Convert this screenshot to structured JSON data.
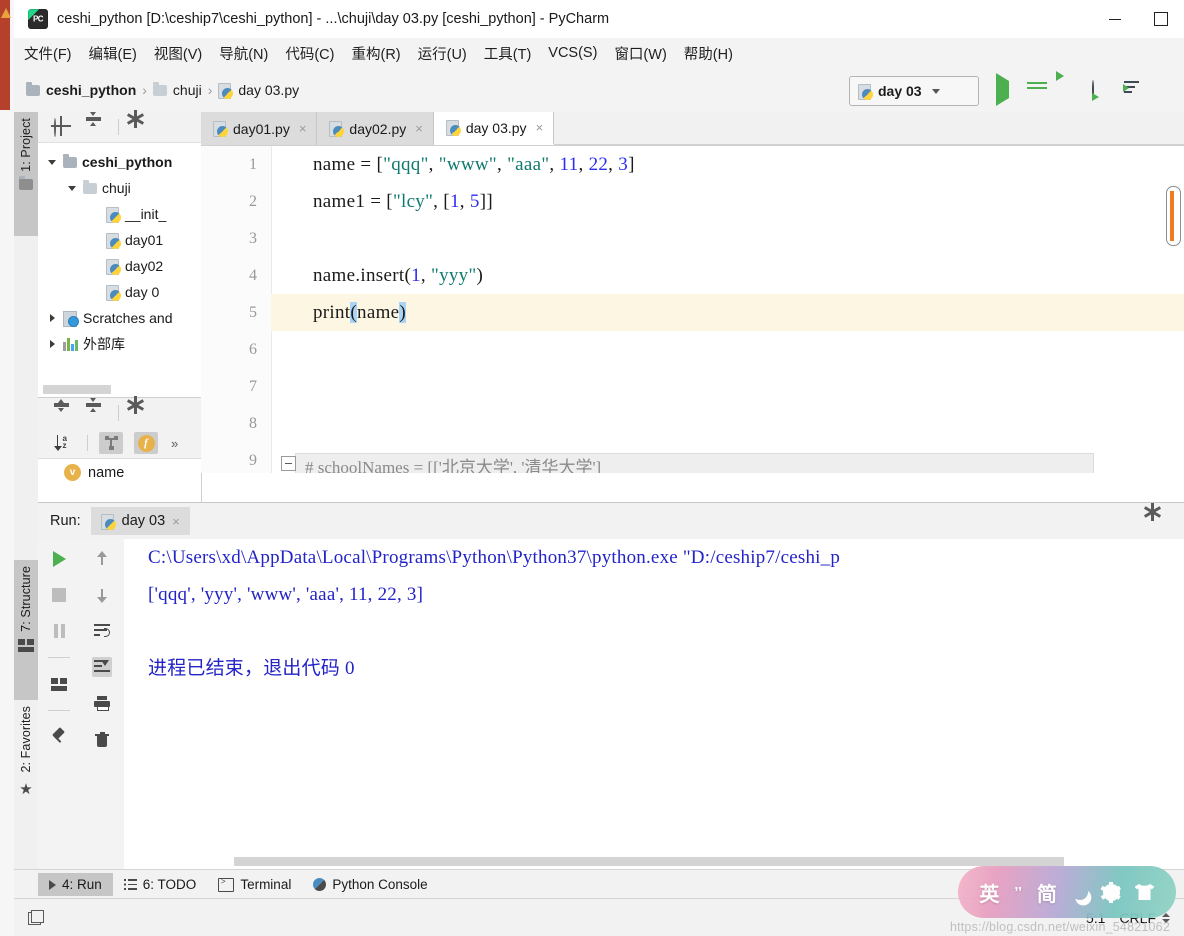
{
  "window": {
    "title": "ceshi_python [D:\\ceship7\\ceshi_python] - ...\\chuji\\day 03.py [ceshi_python] - PyCharm",
    "app_logo": "pycharm-logo",
    "minimize_label": "minimize",
    "maximize_label": "maximize"
  },
  "menubar": {
    "items": [
      {
        "label": "文件(F)",
        "mnemonic": "F"
      },
      {
        "label": "编辑(E)",
        "mnemonic": "E"
      },
      {
        "label": "视图(V)",
        "mnemonic": "V"
      },
      {
        "label": "导航(N)",
        "mnemonic": "N"
      },
      {
        "label": "代码(C)",
        "mnemonic": "C"
      },
      {
        "label": "重构(R)",
        "mnemonic": "R"
      },
      {
        "label": "运行(U)",
        "mnemonic": "U"
      },
      {
        "label": "工具(T)",
        "mnemonic": "T"
      },
      {
        "label": "VCS(S)",
        "mnemonic": "S"
      },
      {
        "label": "窗口(W)",
        "mnemonic": "W"
      },
      {
        "label": "帮助(H)",
        "mnemonic": "H"
      }
    ]
  },
  "navbar": {
    "crumbs": [
      {
        "label": "ceshi_python",
        "icon": "folder-icon"
      },
      {
        "label": "chuji",
        "icon": "folder-icon"
      },
      {
        "label": "day 03.py",
        "icon": "python-file-icon"
      }
    ],
    "separator": "›"
  },
  "run_config": {
    "name": "day 03",
    "icon": "python-file-icon",
    "dropdown": "chevron-down-icon",
    "actions": [
      {
        "name": "run-button",
        "icon": "play-icon"
      },
      {
        "name": "debug-button",
        "icon": "bug-icon"
      },
      {
        "name": "run-with-coverage-button",
        "icon": "coverage-icon"
      },
      {
        "name": "profile-button",
        "icon": "profile-clock-icon"
      },
      {
        "name": "run-with-console-button",
        "icon": "run-list-icon"
      },
      {
        "name": "stop-button",
        "icon": "stop-square-icon"
      }
    ]
  },
  "left_tool_tabs": [
    {
      "label": "1: Project",
      "mnemonic": "1",
      "icon": "folder-icon",
      "active": true
    },
    {
      "label": "7: Structure",
      "mnemonic": "7",
      "icon": "structure-icon",
      "active": true
    },
    {
      "label": "2: Favorites",
      "mnemonic": "2",
      "icon": "star-icon",
      "active": false
    }
  ],
  "project_panel": {
    "toolbar": [
      {
        "name": "locate-file-icon"
      },
      {
        "name": "collapse-all-icon"
      },
      {
        "name": "settings-gear-icon"
      },
      {
        "name": "hide-panel-icon"
      }
    ],
    "tree": [
      {
        "label": "ceshi_python",
        "icon": "folder-icon",
        "indent": 0,
        "twisty": "down",
        "bold": true
      },
      {
        "label": "chuji",
        "icon": "folder-icon",
        "indent": 1,
        "twisty": "down",
        "bold": false
      },
      {
        "label": "__init_",
        "icon": "python-file-icon",
        "indent": 2,
        "twisty": "none",
        "bold": false
      },
      {
        "label": "day01",
        "icon": "python-file-icon",
        "indent": 2,
        "twisty": "none",
        "bold": false
      },
      {
        "label": "day02",
        "icon": "python-file-icon",
        "indent": 2,
        "twisty": "none",
        "bold": false
      },
      {
        "label": "day 0",
        "icon": "python-file-icon",
        "indent": 2,
        "twisty": "none",
        "bold": false
      },
      {
        "label": "Scratches and",
        "icon": "scratches-icon",
        "indent": 0,
        "twisty": "right",
        "bold": false
      },
      {
        "label": "外部库",
        "icon": "external-libraries-icon",
        "indent": 0,
        "twisty": "right",
        "bold": false
      }
    ]
  },
  "structure_panel": {
    "toolbar_row1": [
      {
        "name": "expand-all-icon"
      },
      {
        "name": "collapse-all-icon"
      },
      {
        "name": "settings-gear-icon"
      },
      {
        "name": "hide-panel-icon"
      }
    ],
    "toolbar_row2": [
      {
        "name": "sort-alphabetically-icon",
        "active": false
      },
      {
        "name": "show-inherited-icon",
        "active": true
      },
      {
        "name": "show-fields-icon",
        "active": true,
        "glyph": "f"
      },
      {
        "name": "more-options-icon",
        "glyph": "»"
      }
    ],
    "items": [
      {
        "label": "name",
        "badge": "v"
      }
    ]
  },
  "editor": {
    "tabs": [
      {
        "label": "day01.py",
        "icon": "python-file-icon",
        "active": false,
        "close": "×"
      },
      {
        "label": "day02.py",
        "icon": "python-file-icon",
        "active": false,
        "close": "×"
      },
      {
        "label": "day 03.py",
        "icon": "python-file-icon",
        "active": true,
        "close": "×"
      }
    ],
    "line_numbers": [
      "1",
      "2",
      "3",
      "4",
      "5",
      "6",
      "7",
      "8",
      "9"
    ],
    "code_lines": [
      {
        "n": 1,
        "text": "name = [\"qqq\", \"www\", \"aaa\", 11, 22, 3]"
      },
      {
        "n": 2,
        "text": "name1 = [\"lcy\", [1, 5]]"
      },
      {
        "n": 3,
        "text": ""
      },
      {
        "n": 4,
        "text": "name.insert(1, \"yyy\")"
      },
      {
        "n": 5,
        "text": "print(name)",
        "current": true
      },
      {
        "n": 6,
        "text": ""
      },
      {
        "n": 7,
        "text": ""
      },
      {
        "n": 8,
        "text": ""
      },
      {
        "n": 9,
        "text": ""
      }
    ],
    "ghost_line": "# schoolNames = [['北京大学', '清华大学']",
    "scrollbar_color": "#f07c1e"
  },
  "run_window": {
    "label": "Run:",
    "tab": {
      "label": "day 03",
      "icon": "python-file-icon",
      "close": "×"
    },
    "settings_icon": "settings-gear-icon",
    "side_actions": [
      {
        "name": "rerun-button",
        "icon": "play-icon"
      },
      {
        "name": "stop-button",
        "icon": "stop-square-icon"
      },
      {
        "name": "pause-button",
        "icon": "pause-icon"
      },
      {
        "name": "layout-button",
        "icon": "layout-icon"
      },
      {
        "name": "pin-tab-button",
        "icon": "pin-icon"
      }
    ],
    "side_actions2": [
      {
        "name": "up-stack-button",
        "icon": "arrow-up-icon"
      },
      {
        "name": "down-stack-button",
        "icon": "arrow-down-icon"
      },
      {
        "name": "soft-wrap-button",
        "icon": "wrap-text-icon"
      },
      {
        "name": "scroll-to-end-button",
        "icon": "scroll-end-icon",
        "active": true
      },
      {
        "name": "print-button",
        "icon": "printer-icon"
      },
      {
        "name": "clear-all-button",
        "icon": "trash-icon"
      }
    ],
    "console_lines": [
      "C:\\Users\\xd\\AppData\\Local\\Programs\\Python\\Python37\\python.exe \"D:/ceship7/ceshi_p",
      "['qqq', 'yyy', 'www', 'aaa', 11, 22, 3]",
      "",
      "进程已结束，退出代码 0"
    ]
  },
  "bottom_bar": {
    "items": [
      {
        "label": "4: Run",
        "mnemonic": "4",
        "icon": "play-icon",
        "active": true
      },
      {
        "label": "6: TODO",
        "mnemonic": "6",
        "icon": "todo-list-icon",
        "active": false
      },
      {
        "label": "Terminal",
        "mnemonic": "",
        "icon": "terminal-icon",
        "active": false
      },
      {
        "label": "Python Console",
        "mnemonic": "",
        "icon": "python-icon",
        "active": false
      }
    ]
  },
  "statusbar": {
    "left_icon": "event-log-icon",
    "caret_position": "5:1",
    "line_separator": "CRLF"
  },
  "ime_bar": {
    "items": [
      {
        "label": "英",
        "name": "ime-language-toggle"
      },
      {
        "label": "’’",
        "name": "ime-punctuation-toggle"
      },
      {
        "label": "简",
        "name": "ime-simplified-toggle"
      },
      {
        "label": "",
        "name": "ime-moon-icon"
      },
      {
        "label": "",
        "name": "ime-settings-gear-icon"
      },
      {
        "label": "",
        "name": "ime-skin-shirt-icon"
      }
    ]
  },
  "watermark": {
    "text": "https://blog.csdn.net/weixin_54821062"
  }
}
